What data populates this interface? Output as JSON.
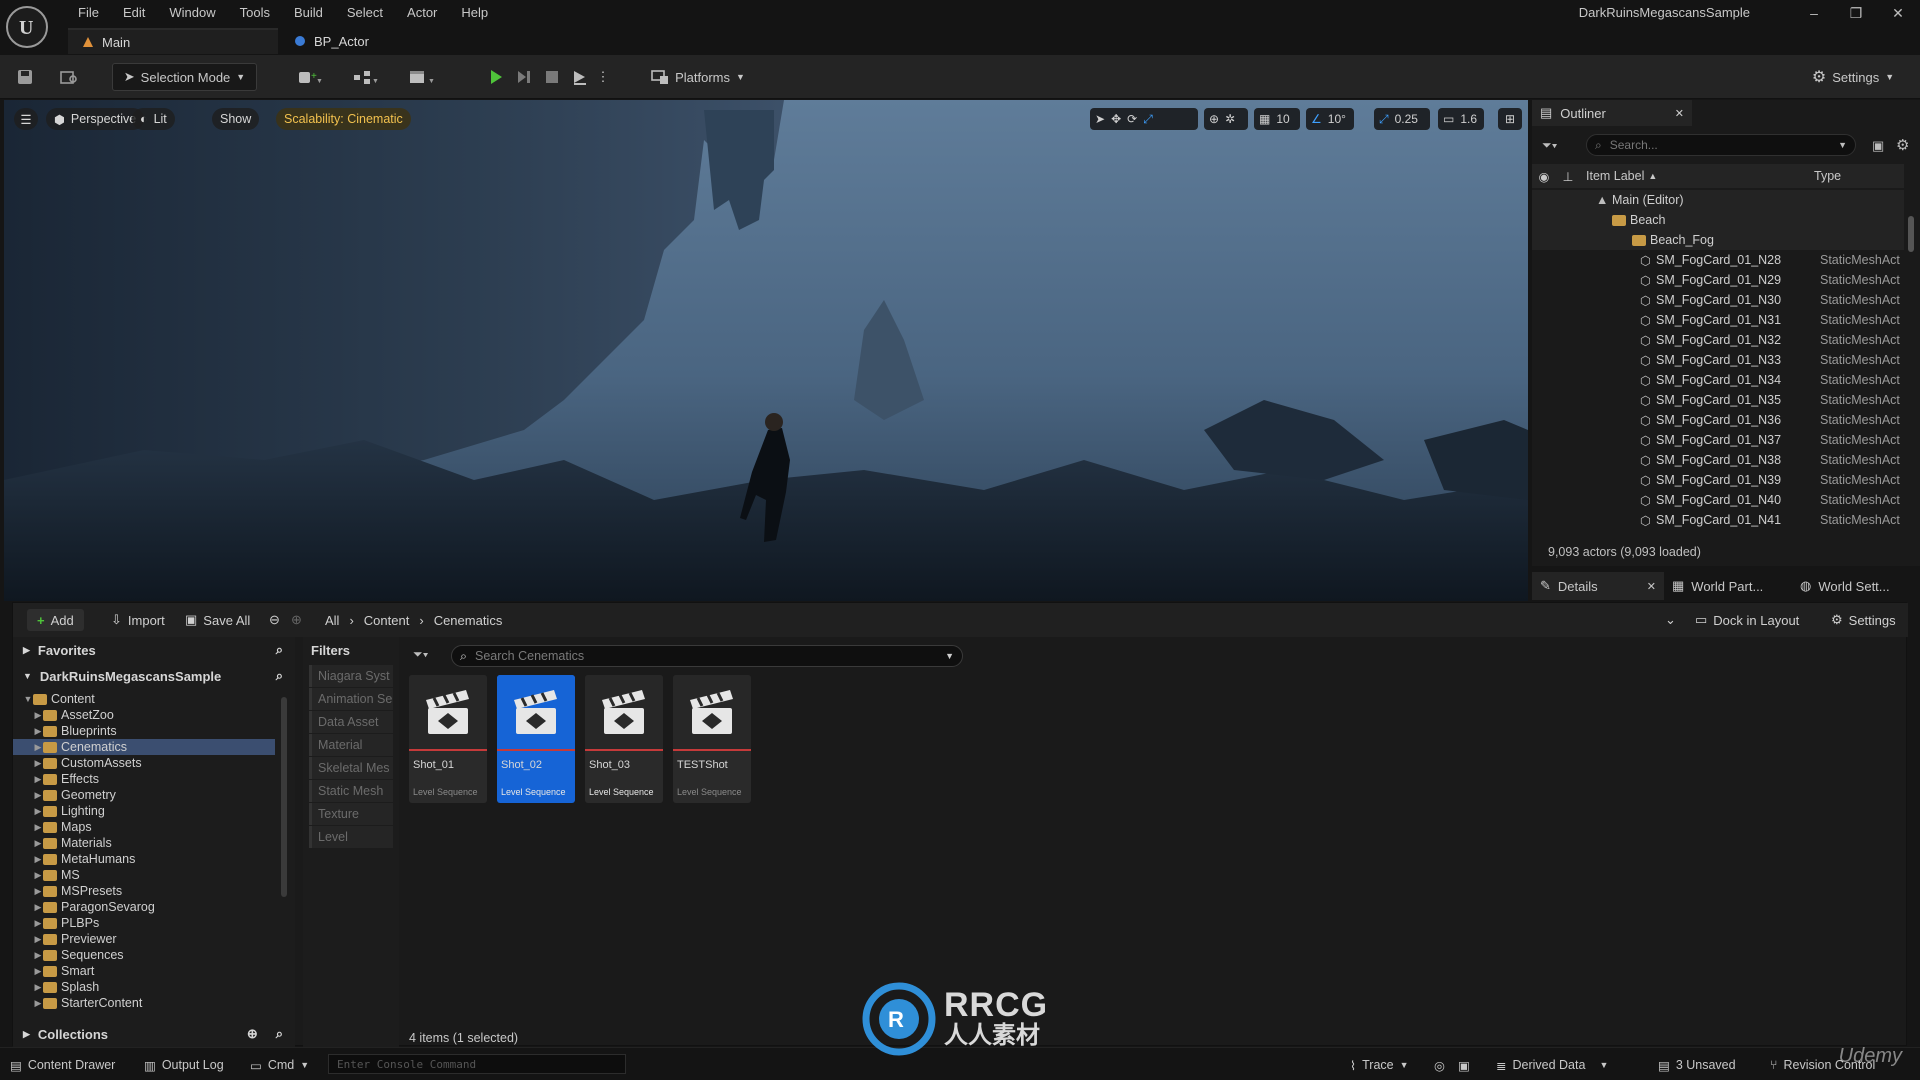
{
  "app": {
    "title": "DarkRuinsMegascansSample",
    "menu": [
      "File",
      "Edit",
      "Window",
      "Tools",
      "Build",
      "Select",
      "Actor",
      "Help"
    ],
    "tabs": [
      "Main",
      "BP_Actor"
    ]
  },
  "toolbar": {
    "selection_mode": "Selection Mode",
    "platforms": "Platforms",
    "settings": "Settings"
  },
  "viewport": {
    "perspective": "Perspective",
    "lit": "Lit",
    "show": "Show",
    "scalability": "Scalability: Cinematic",
    "grid_snap": "10",
    "rot_snap": "10°",
    "scale_snap": "0.25",
    "cam_speed": "1.6"
  },
  "outliner": {
    "title": "Outliner",
    "search_placeholder": "Search...",
    "col_label": "Item Label",
    "col_type": "Type",
    "tree": [
      {
        "label": "Main (Editor)",
        "type": ""
      },
      {
        "label": "Beach",
        "type": ""
      },
      {
        "label": "Beach_Fog",
        "type": ""
      }
    ],
    "rows": [
      {
        "label": "SM_FogCard_01_N28",
        "type": "StaticMeshAct"
      },
      {
        "label": "SM_FogCard_01_N29",
        "type": "StaticMeshAct"
      },
      {
        "label": "SM_FogCard_01_N30",
        "type": "StaticMeshAct"
      },
      {
        "label": "SM_FogCard_01_N31",
        "type": "StaticMeshAct"
      },
      {
        "label": "SM_FogCard_01_N32",
        "type": "StaticMeshAct"
      },
      {
        "label": "SM_FogCard_01_N33",
        "type": "StaticMeshAct"
      },
      {
        "label": "SM_FogCard_01_N34",
        "type": "StaticMeshAct"
      },
      {
        "label": "SM_FogCard_01_N35",
        "type": "StaticMeshAct"
      },
      {
        "label": "SM_FogCard_01_N36",
        "type": "StaticMeshAct"
      },
      {
        "label": "SM_FogCard_01_N37",
        "type": "StaticMeshAct"
      },
      {
        "label": "SM_FogCard_01_N38",
        "type": "StaticMeshAct"
      },
      {
        "label": "SM_FogCard_01_N39",
        "type": "StaticMeshAct"
      },
      {
        "label": "SM_FogCard_01_N40",
        "type": "StaticMeshAct"
      },
      {
        "label": "SM_FogCard_01_N41",
        "type": "StaticMeshAct"
      }
    ],
    "actor_count": "9,093 actors (9,093 loaded)"
  },
  "details_tabs": [
    "Details",
    "World Part...",
    "World Sett..."
  ],
  "content_browser": {
    "add": "Add",
    "import": "Import",
    "save_all": "Save All",
    "breadcrumb": [
      "All",
      "Content",
      "Cenematics"
    ],
    "dock": "Dock in Layout",
    "settings": "Settings",
    "favorites": "Favorites",
    "project": "DarkRuinsMegascansSample",
    "collections": "Collections",
    "filters_title": "Filters",
    "filters": [
      "Niagara Syst",
      "Animation Se",
      "Data Asset",
      "Material",
      "Skeletal Mes",
      "Static Mesh",
      "Texture",
      "Level"
    ],
    "search_placeholder": "Search Cenematics",
    "folders": [
      {
        "name": "Content",
        "depth": 0,
        "expanded": true
      },
      {
        "name": "AssetZoo",
        "depth": 1
      },
      {
        "name": "Blueprints",
        "depth": 1
      },
      {
        "name": "Cenematics",
        "depth": 1,
        "selected": true
      },
      {
        "name": "CustomAssets",
        "depth": 1
      },
      {
        "name": "Effects",
        "depth": 1
      },
      {
        "name": "Geometry",
        "depth": 1
      },
      {
        "name": "Lighting",
        "depth": 1
      },
      {
        "name": "Maps",
        "depth": 1
      },
      {
        "name": "Materials",
        "depth": 1
      },
      {
        "name": "MetaHumans",
        "depth": 1
      },
      {
        "name": "MS",
        "depth": 1
      },
      {
        "name": "MSPresets",
        "depth": 1
      },
      {
        "name": "ParagonSevarog",
        "depth": 1
      },
      {
        "name": "PLBPs",
        "depth": 1
      },
      {
        "name": "Previewer",
        "depth": 1
      },
      {
        "name": "Sequences",
        "depth": 1
      },
      {
        "name": "Smart",
        "depth": 1
      },
      {
        "name": "Splash",
        "depth": 1
      },
      {
        "name": "StarterContent",
        "depth": 1
      }
    ],
    "assets": [
      {
        "name": "Shot_01",
        "type": "Level Sequence"
      },
      {
        "name": "Shot_02",
        "type": "Level Sequence"
      },
      {
        "name": "Shot_03",
        "type": "Level Sequence"
      },
      {
        "name": "TESTShot",
        "type": "Level Sequence"
      }
    ],
    "items_count": "4 items (1 selected)"
  },
  "statusbar": {
    "content_drawer": "Content Drawer",
    "output_log": "Output Log",
    "cmd": "Cmd",
    "console_placeholder": "Enter Console Command",
    "trace": "Trace",
    "derived_data": "Derived Data",
    "unsaved": "3 Unsaved",
    "revision": "Revision Control"
  },
  "watermarks": {
    "rrcg_top": "RRCG",
    "rrcg_bottom": "人人素材",
    "udemy": "Udemy"
  },
  "colors": {
    "accent": "#1664d6",
    "play": "#4fc43a",
    "scalability": "#f2c14e",
    "folder": "#c79a45"
  }
}
